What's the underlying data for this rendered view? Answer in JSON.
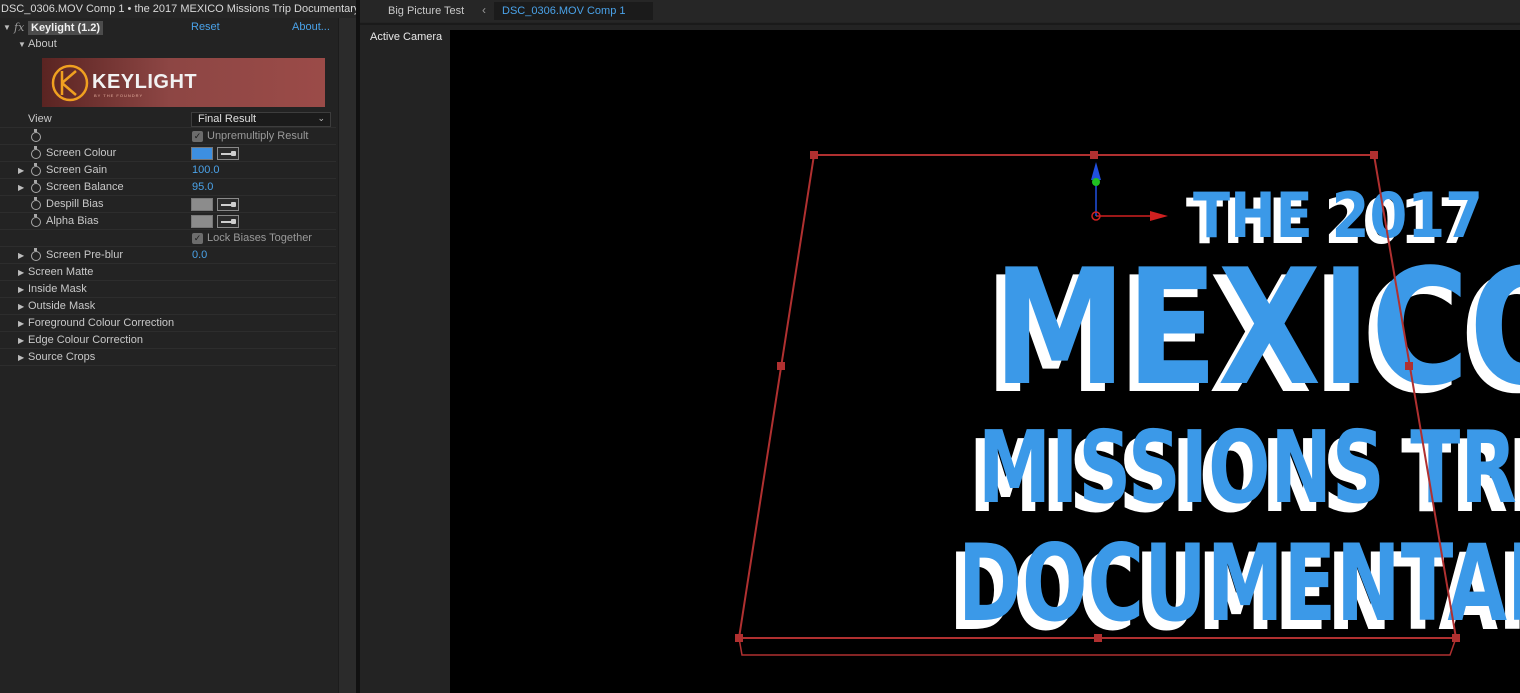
{
  "window": {
    "panel_title": "DSC_0306.MOV Comp 1 • the 2017 MEXICO Missions Trip Documentary"
  },
  "effect": {
    "fx_symbol": "fx",
    "name": "Keylight (1.2)",
    "reset_label": "Reset",
    "about_link": "About...",
    "about_section": "About",
    "logo_text": "KEYLIGHT",
    "logo_subtext": "BY THE FOUNDRY"
  },
  "properties": {
    "view": {
      "label": "View",
      "value": "Final Result"
    },
    "unpremultiply": {
      "label": "Unpremultiply Result",
      "checked": true
    },
    "screen_colour": {
      "label": "Screen Colour",
      "color": "#3d8fe0"
    },
    "screen_gain": {
      "label": "Screen Gain",
      "value": "100.0"
    },
    "screen_balance": {
      "label": "Screen Balance",
      "value": "95.0"
    },
    "despill_bias": {
      "label": "Despill Bias",
      "color": "#8c8c8c"
    },
    "alpha_bias": {
      "label": "Alpha Bias",
      "color": "#8c8c8c"
    },
    "lock_biases": {
      "label": "Lock Biases Together",
      "checked": true
    },
    "screen_preblur": {
      "label": "Screen Pre-blur",
      "value": "0.0"
    }
  },
  "sections": [
    "Screen Matte",
    "Inside Mask",
    "Outside Mask",
    "Foreground Colour Correction",
    "Edge Colour Correction",
    "Source Crops"
  ],
  "viewer": {
    "tab_inactive": "Big Picture Test",
    "tab_active": "DSC_0306.MOV Comp 1",
    "camera_label": "Active Camera",
    "title_lines": [
      "THE 2017",
      "MEXICO",
      "MISSIONS TRIP",
      "DOCUMENTARY"
    ],
    "text_color": "#3b99e8",
    "extrude_color": "#ffffff",
    "bbox_color": "#b03030"
  },
  "colors": {
    "accent": "#4aa2e8",
    "panel_bg": "#232323"
  }
}
